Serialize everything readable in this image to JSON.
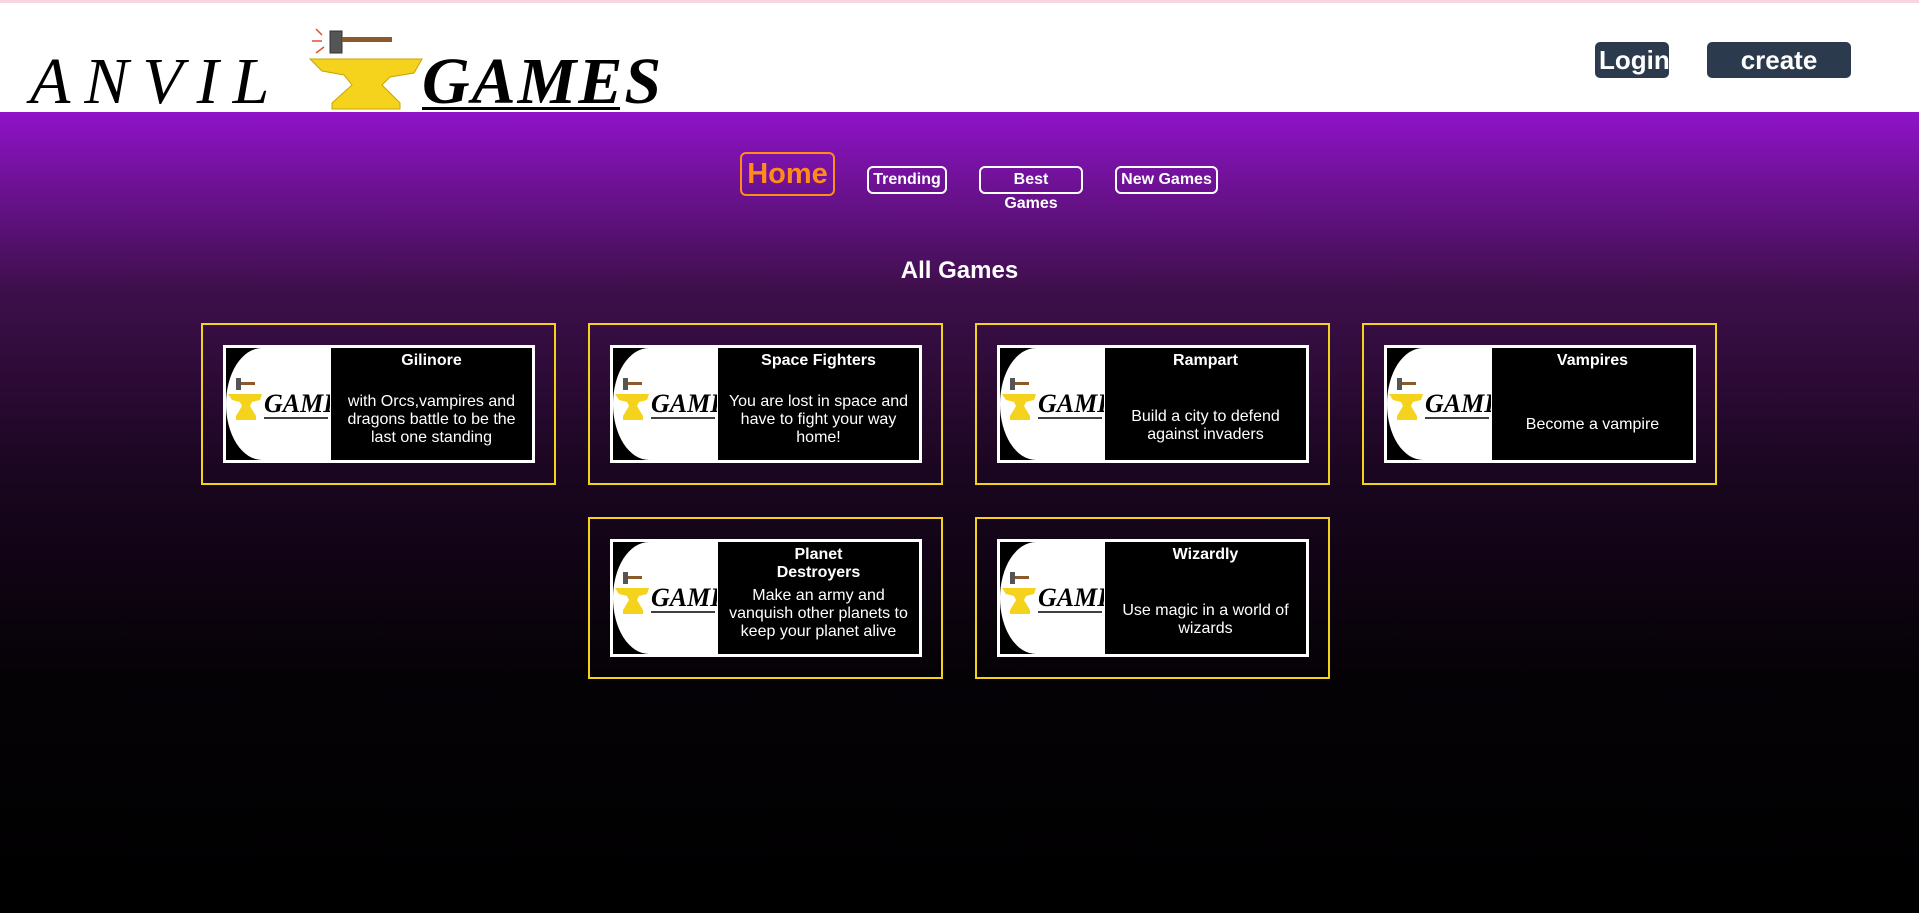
{
  "header": {
    "logo": {
      "left_text": "ANVIL",
      "right_text": "GAMES",
      "icon": "anvil-hammer-icon"
    },
    "login_label": "Login",
    "create_user_label": "create User"
  },
  "nav": {
    "home": "Home",
    "trending": "Trending",
    "best_games": "Best Games",
    "new_games": "New Games"
  },
  "section_title": "All Games",
  "games": [
    {
      "title": "Gilinore",
      "description": "with Orcs,vampires and dragons battle to be the last one standing",
      "thumbnail_text": "GAMES"
    },
    {
      "title": "Space Fighters",
      "description": "You are lost in space and have to fight your way home!",
      "thumbnail_text": "GAMES"
    },
    {
      "title": "Rampart",
      "description": "Build a city to defend against invaders",
      "thumbnail_text": "GAMES"
    },
    {
      "title": "Vampires",
      "description": "Become a vampire",
      "thumbnail_text": "GAMES"
    },
    {
      "title": "Planet Destroyers",
      "description": "Make an army and vanquish other planets to keep your planet alive",
      "thumbnail_text": "GAMES"
    },
    {
      "title": "Wizardly",
      "description": "Use magic in a world of wizards",
      "thumbnail_text": "GAMES"
    }
  ],
  "colors": {
    "accent_orange": "#ff8c1a",
    "card_border": "#f2d21a",
    "button_dark": "#2b3a4c",
    "purple_top": "#9013c9",
    "anvil_yellow": "#f5d21c"
  }
}
